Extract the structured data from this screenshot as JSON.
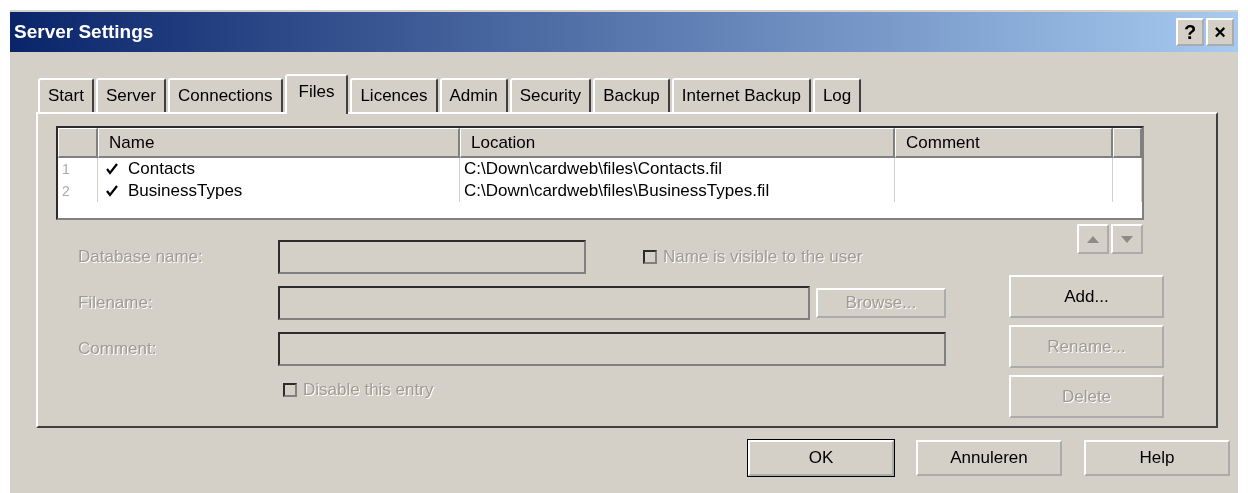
{
  "window": {
    "title": "Server Settings",
    "title_buttons": [
      "?",
      "×"
    ]
  },
  "tabs": [
    {
      "label": "Start",
      "selected": false
    },
    {
      "label": "Server",
      "selected": false
    },
    {
      "label": "Connections",
      "selected": false
    },
    {
      "label": "Files",
      "selected": true
    },
    {
      "label": "Licences",
      "selected": false
    },
    {
      "label": "Admin",
      "selected": false
    },
    {
      "label": "Security",
      "selected": false
    },
    {
      "label": "Backup",
      "selected": false
    },
    {
      "label": "Internet Backup",
      "selected": false
    },
    {
      "label": "Log",
      "selected": false
    }
  ],
  "table": {
    "columns": [
      "Name",
      "Location",
      "Comment"
    ],
    "rows": [
      {
        "number": "1",
        "checked": true,
        "name": "Contacts",
        "location": "C:\\Down\\cardweb\\files\\Contacts.fil"
      },
      {
        "number": "2",
        "checked": true,
        "name": "BusinessTypes",
        "location": "C:\\Down\\cardweb\\files\\BusinessTypes.fil"
      }
    ]
  },
  "move_buttons": {
    "disabled": true
  },
  "form": {
    "database_name": {
      "label": "Database name:",
      "disabled": true
    },
    "visible_checkbox": {
      "label": "Name is visible to the user",
      "checked": false,
      "disabled": true
    },
    "filename": {
      "label": "Filename:",
      "disabled": true
    },
    "browse_button": {
      "label": "Browse...",
      "disabled": true
    },
    "comment": {
      "label": "Comment:",
      "disabled": true
    },
    "disable_checkbox": {
      "label": "Disable this entry",
      "checked": false,
      "disabled": true
    }
  },
  "side_buttons": [
    {
      "label": "Add...",
      "disabled": false
    },
    {
      "label": "Rename...",
      "disabled": true
    },
    {
      "label": "Delete",
      "disabled": true
    }
  ],
  "footer_buttons": [
    {
      "label": "OK",
      "default": true
    },
    {
      "label": "Annuleren",
      "default": false
    },
    {
      "label": "Help",
      "default": false
    }
  ]
}
